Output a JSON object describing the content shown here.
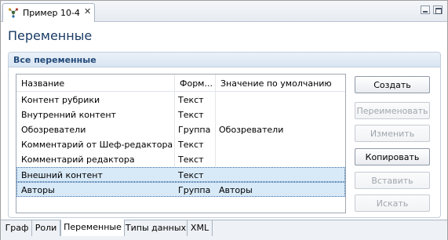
{
  "editor_tab": {
    "title": "Пример 10-4",
    "close": "✕"
  },
  "page_title": "Переменные",
  "section": {
    "title": "Все переменные"
  },
  "table": {
    "columns": [
      "Название",
      "Форм...",
      "Значение по умолчанию"
    ],
    "rows": [
      {
        "name": "Контент рубрики",
        "format": "Текст",
        "default": ""
      },
      {
        "name": "Внутренний контент",
        "format": "Текст",
        "default": ""
      },
      {
        "name": "Обозреватели",
        "format": "Группа",
        "default": "Обозреватели"
      },
      {
        "name": "Комментарий от Шеф-редактора",
        "format": "Текст",
        "default": ""
      },
      {
        "name": "Комментарий редактора",
        "format": "Текст",
        "default": ""
      },
      {
        "name": "Внешний контент",
        "format": "Текст",
        "default": ""
      },
      {
        "name": "Авторы",
        "format": "Группа",
        "default": "Авторы"
      }
    ]
  },
  "buttons": {
    "create": "Создать",
    "rename": "Переименовать",
    "edit": "Изменить",
    "copy": "Копировать",
    "paste": "Вставить",
    "search": "Искать"
  },
  "bottom_tabs": [
    "Граф",
    "Роли",
    "Переменные",
    "Типы данных",
    "XML"
  ]
}
